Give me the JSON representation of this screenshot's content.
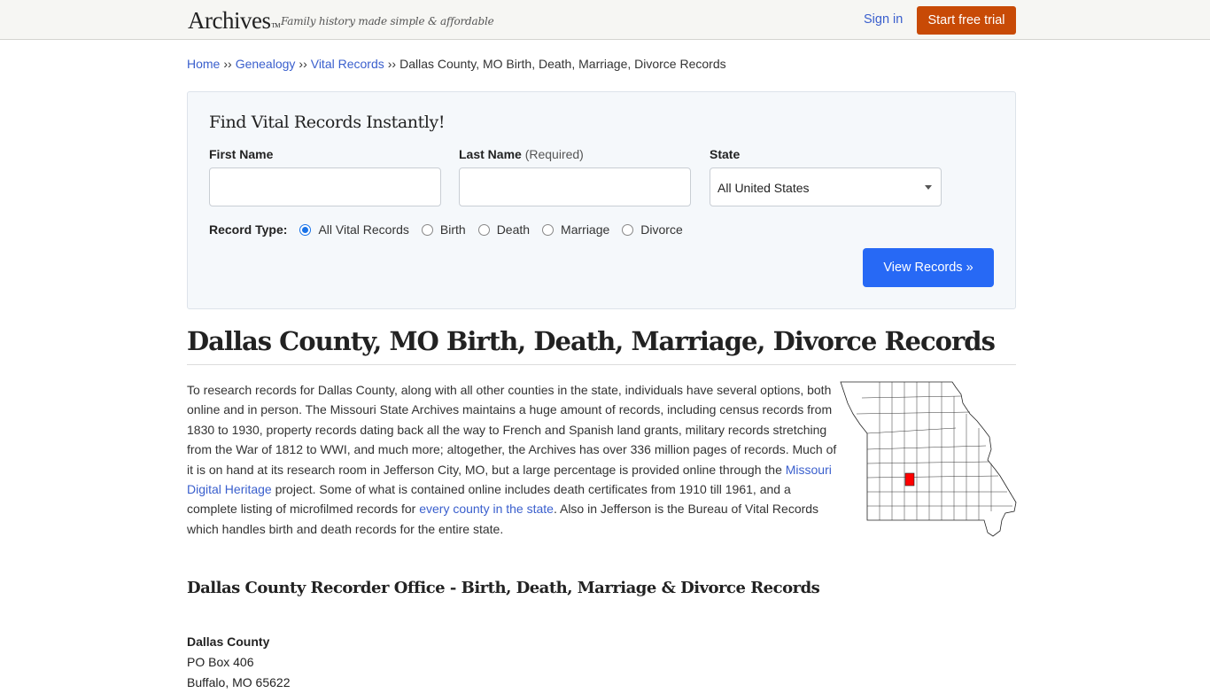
{
  "header": {
    "logo": "Archives",
    "logo_tm": "TM",
    "tagline": "Family history made simple & affordable",
    "signin_label": "Sign in",
    "trial_label": "Start free trial"
  },
  "breadcrumb": {
    "items": [
      "Home",
      "Genealogy",
      "Vital Records"
    ],
    "separator": "››",
    "current": "Dallas County, MO Birth, Death, Marriage, Divorce Records"
  },
  "search": {
    "title": "Find Vital Records Instantly!",
    "first_name_label": "First Name",
    "first_name_value": "",
    "last_name_label": "Last Name",
    "last_name_hint": "(Required)",
    "last_name_value": "",
    "state_label": "State",
    "state_value": "All United States",
    "record_type_label": "Record Type:",
    "record_types": [
      {
        "label": "All Vital Records",
        "checked": true
      },
      {
        "label": "Birth",
        "checked": false
      },
      {
        "label": "Death",
        "checked": false
      },
      {
        "label": "Marriage",
        "checked": false
      },
      {
        "label": "Divorce",
        "checked": false
      }
    ],
    "submit_label": "View Records »"
  },
  "main": {
    "title": "Dallas County, MO Birth, Death, Marriage, Divorce Records",
    "intro_part1": "To research records for Dallas County, along with all other counties in the state, individuals have several options, both online and in person. The Missouri State Archives maintains a huge amount of records, including census records from 1830 to 1930, property records dating back all the way to French and Spanish land grants, military records stretching from the War of 1812 to WWI, and much more; altogether, the Archives has over 336 million pages of records. Much of it is on hand at its research room in Jefferson City, MO, but a large percentage is provided online through the ",
    "intro_link1": "Missouri Digital Heritage",
    "intro_part2": " project. Some of what is contained online includes death certificates from 1910 till 1961, and a complete listing of microfilmed records for ",
    "intro_link2": "every county in the state",
    "intro_part3": ". Also in Jefferson is the Bureau of Vital Records which handles birth and death records for the entire state.",
    "map_alt": "Missouri county map with Dallas County highlighted",
    "highlight_color": "#ff0000",
    "section_title": "Dallas County Recorder Office - Birth, Death, Marriage & Divorce Records",
    "office": {
      "name": "Dallas County",
      "line1": "PO Box 406",
      "line2": "Buffalo, MO 65622"
    }
  }
}
